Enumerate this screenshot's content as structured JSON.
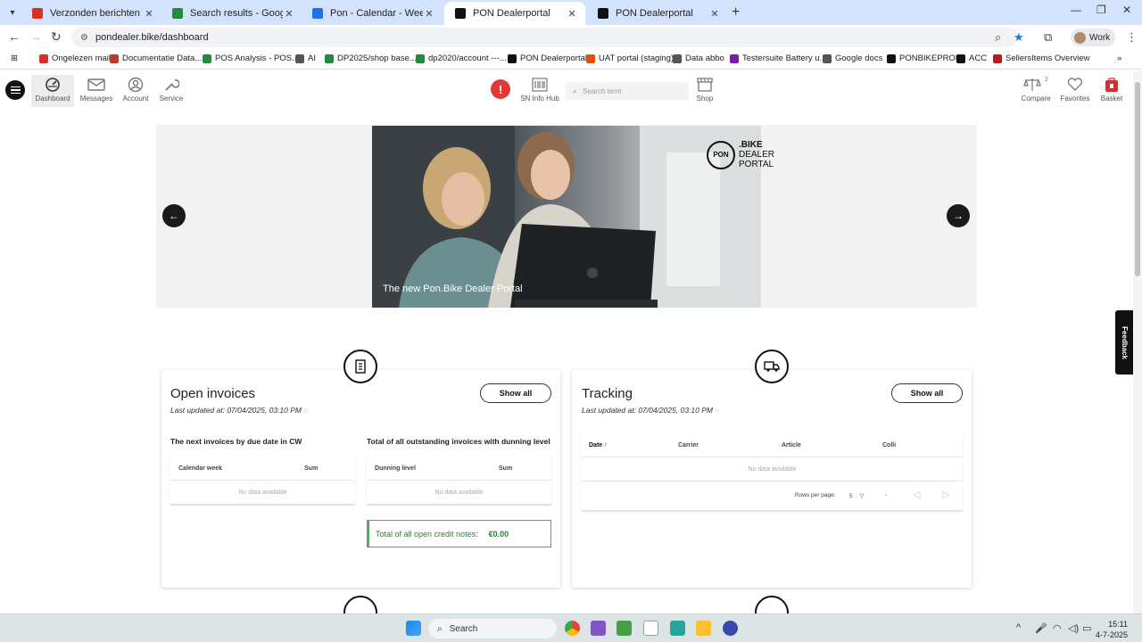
{
  "browser": {
    "tabs": [
      {
        "title": "Verzonden berichten - pieter.d",
        "icon": "gmail-icon",
        "color": "#d93025"
      },
      {
        "title": "Search results - Google Drive",
        "icon": "drive-icon",
        "color": "#1e8e3e"
      },
      {
        "title": "Pon - Calendar - Week of June",
        "icon": "calendar-icon",
        "color": "#1a73e8"
      },
      {
        "title": "PON Dealerportal",
        "icon": "pon-icon",
        "color": "#111111"
      },
      {
        "title": "PON Dealerportal",
        "icon": "pon-icon",
        "color": "#111111"
      }
    ],
    "active_tab": 3,
    "url": "pondealer.bike/dashboard",
    "profile_label": "Work",
    "bookmarks": [
      "Ongelezen mail",
      "Documentatie Data...",
      "POS Analysis - POS...",
      "AI",
      "DP2025/shop base...",
      "dp2020/account ---...",
      "PON Dealerportal",
      "UAT portal (staging)",
      "Data abbo",
      "Testersuite Battery u...",
      "Google docs",
      "PONBIKEPROD",
      "ACC",
      "SellersItems Overview"
    ]
  },
  "header": {
    "nav": [
      {
        "label": "Dashboard",
        "icon": "dashboard-icon"
      },
      {
        "label": "Messages",
        "icon": "mail-icon"
      },
      {
        "label": "Account",
        "icon": "user-icon"
      },
      {
        "label": "Service",
        "icon": "wrench-icon"
      }
    ],
    "alert": "!",
    "sn_info_hub": "SN Info Hub",
    "search_placeholder": "Search term",
    "shop": "Shop",
    "compare": "Compare",
    "compare_count": "2",
    "favorites": "Favorites",
    "basket": "Basket"
  },
  "banner": {
    "caption": "The new Pon.Bike Dealer Portal",
    "logo_lines": [
      "PON",
      ".BIKE",
      "DEALER",
      "PORTAL"
    ]
  },
  "invoices": {
    "title": "Open invoices",
    "updated": "Last updated at: 07/04/2025, 03:10 PM",
    "show_all": "Show all",
    "due_heading": "The next invoices by due date in CW",
    "due_cols": [
      "Calendar week",
      "Sum"
    ],
    "due_empty": "No data available",
    "dunning_heading": "Total of all outstanding invoices with dunning level",
    "dunning_cols": [
      "Dunning level",
      "Sum"
    ],
    "dunning_empty": "No data available",
    "credit_label": "Total of all open credit notes:",
    "credit_value": "€0.00"
  },
  "tracking": {
    "title": "Tracking",
    "updated": "Last updated at: 07/04/2025, 03:10 PM",
    "show_all": "Show all",
    "cols": [
      "Date",
      "Carrier",
      "Article",
      "Colli"
    ],
    "empty": "No data available",
    "rows_per_page_label": "Rows per page:",
    "rows_per_page": "5",
    "range": "-"
  },
  "feedback": "Feedback",
  "taskbar": {
    "search": "Search",
    "time": "15:11",
    "date": "4-7-2025"
  }
}
